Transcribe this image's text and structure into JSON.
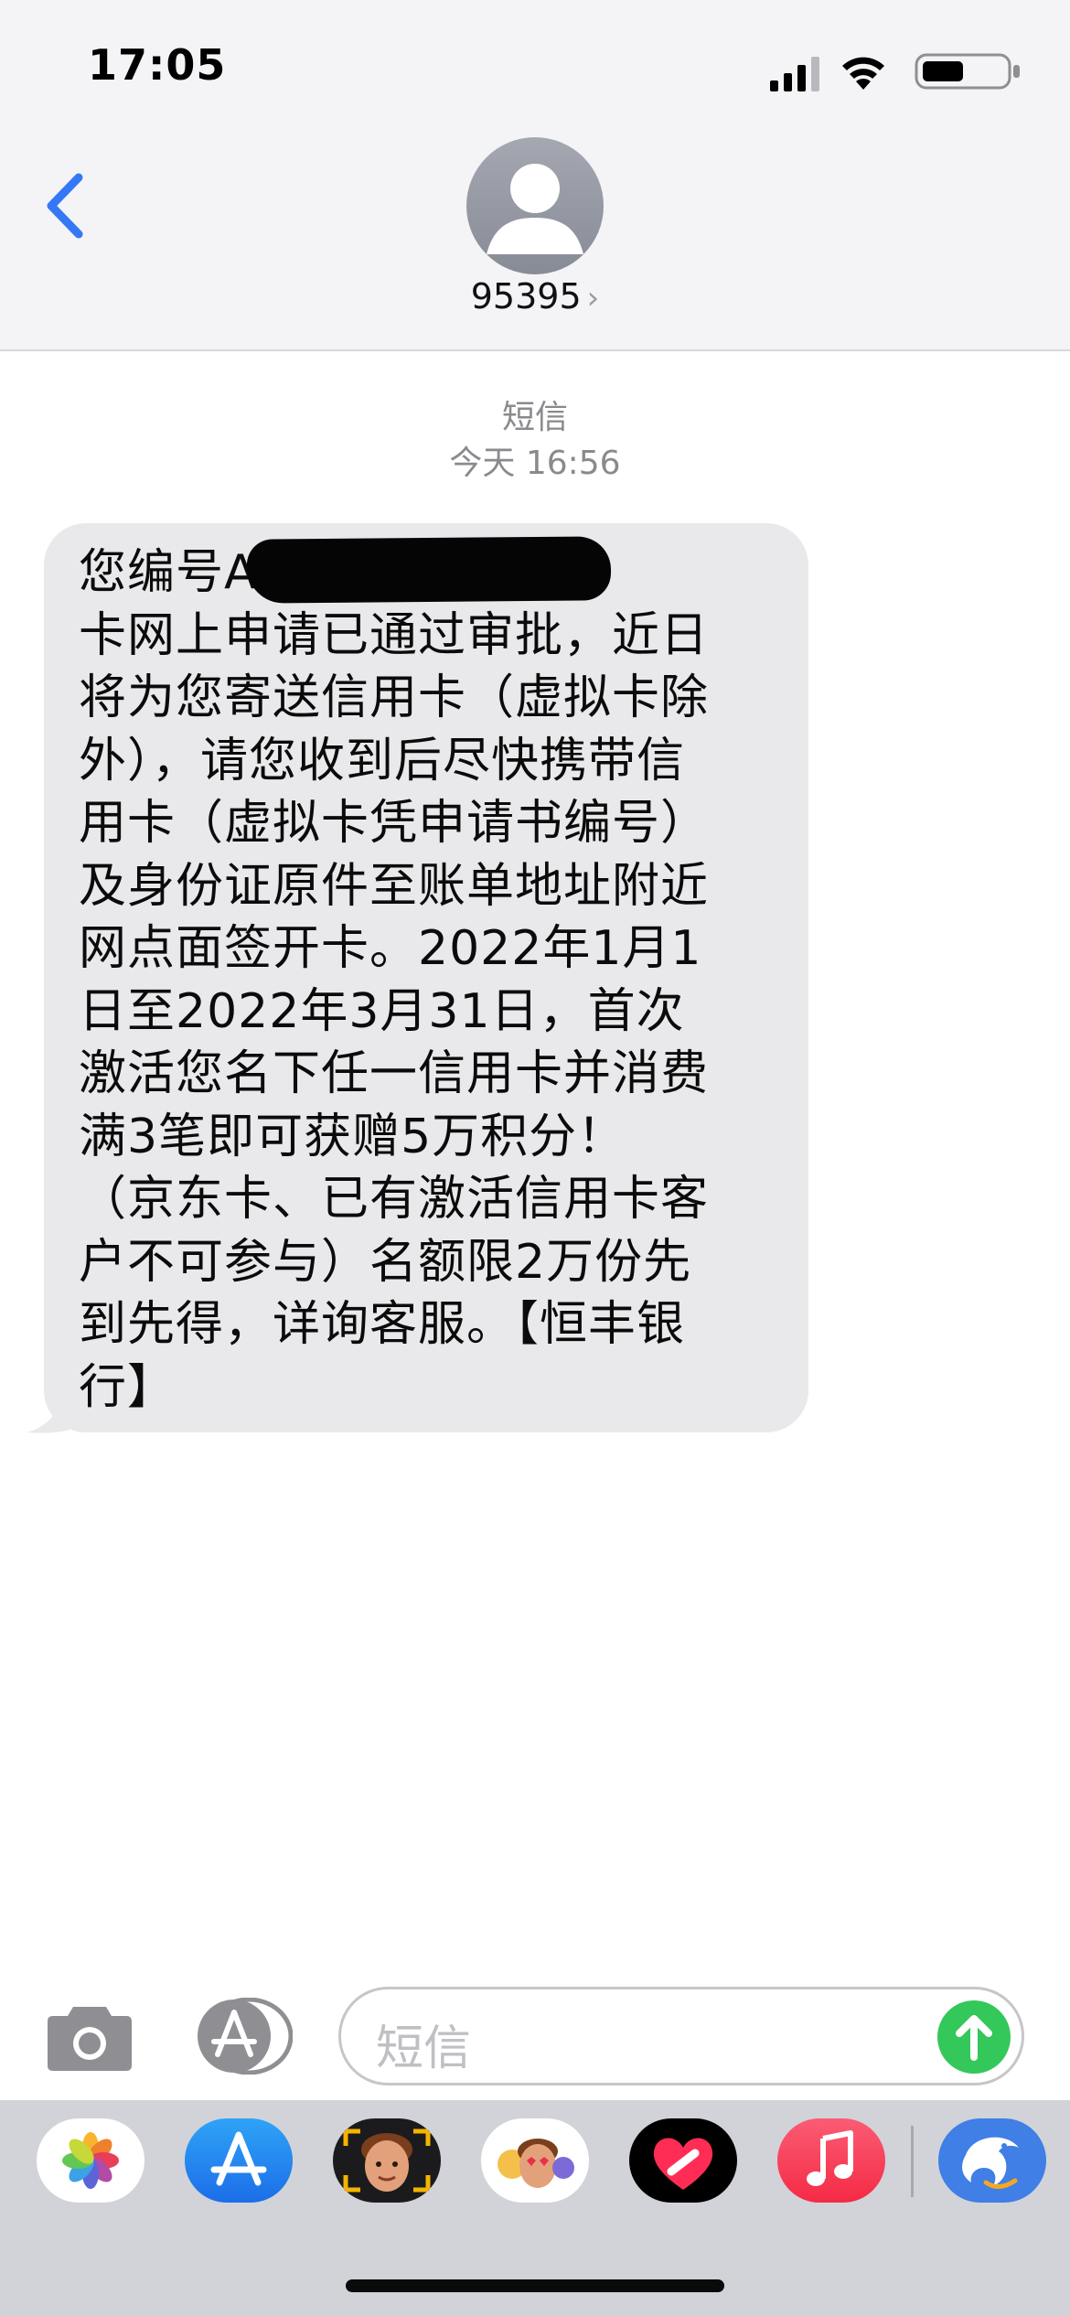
{
  "status_bar": {
    "time": "17:05"
  },
  "header": {
    "contact_name": "95395",
    "chevron": "›"
  },
  "conversation": {
    "service_label": "短信",
    "timestamp": "今天 16:56",
    "message": "您编号A           的信用\n卡网上申请已通过审批，近日\n将为您寄送信用卡（虚拟卡除\n外），请您收到后尽快携带信\n用卡（虚拟卡凭申请书编号）\n及身份证原件至账单地址附近\n网点面签开卡。2022年1月1\n日至2022年3月31日，首次\n激活您名下任一信用卡并消费\n满3笔即可获赠5万积分！\n（京东卡、已有激活信用卡客\n户不可参与）名额限2万份先\n到先得，详询客服。【恒丰银\n行】"
  },
  "compose": {
    "placeholder": "短信"
  },
  "colors": {
    "accent": "#3478f6",
    "send": "#34c759",
    "bubble": "#e9e9eb",
    "header_bg": "#f4f4f6"
  },
  "app_drawer": {
    "apps": [
      "photos-icon",
      "app-store-icon",
      "memoji-icon",
      "animoji-icon",
      "digital-touch-icon",
      "music-icon",
      "ctrip-icon"
    ]
  }
}
